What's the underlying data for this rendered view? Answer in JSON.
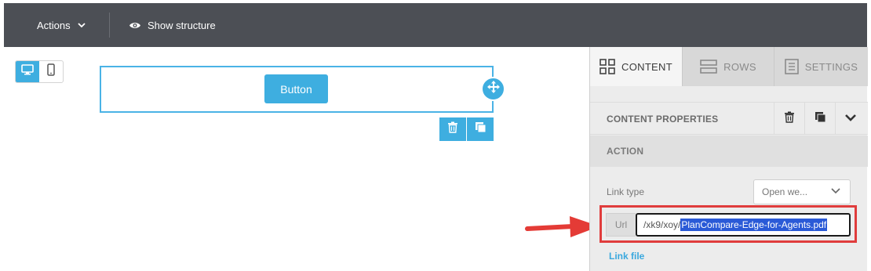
{
  "topbar": {
    "actions_label": "Actions",
    "structure_label": "Show structure"
  },
  "canvas": {
    "button_label": "Button"
  },
  "panel": {
    "tabs": [
      {
        "label": "CONTENT",
        "icon": "grid-icon",
        "active": true
      },
      {
        "label": "ROWS",
        "icon": "rows-icon",
        "active": false
      },
      {
        "label": "SETTINGS",
        "icon": "settings-doc-icon",
        "active": false
      }
    ],
    "content_properties_title": "CONTENT PROPERTIES",
    "action_title": "ACTION",
    "link_type_label": "Link type",
    "link_type_value": "Open we...",
    "url_prefix": "Url",
    "url_value_plain": "/xk9/xoy/",
    "url_value_selected": "PlanCompare-Edge-for-Agents.pdf",
    "link_file_label": "Link file"
  },
  "colors": {
    "accent": "#3eaee0",
    "topbar": "#4c4f55",
    "highlight_box": "#e03c3c",
    "text_selection": "#2a5ad7"
  }
}
